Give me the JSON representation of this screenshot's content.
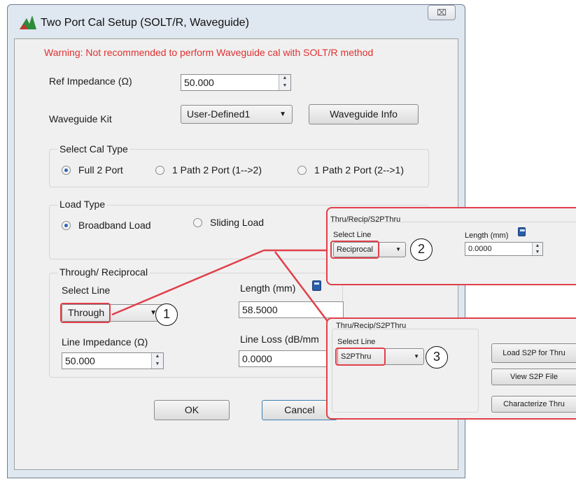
{
  "window": {
    "title": "Two Port Cal Setup (SOLT/R, Waveguide)",
    "close_glyph": "⌧"
  },
  "warning": "Warning:  Not recommended to perform Waveguide cal with SOLT/R method",
  "ref_impedance": {
    "label": "Ref Impedance (Ω)",
    "value": "50.000"
  },
  "waveguide_kit": {
    "label": "Waveguide  Kit",
    "selected": "User-Defined1",
    "info_button": "Waveguide Info"
  },
  "cal_type": {
    "legend": "Select Cal Type",
    "options": [
      "Full 2 Port",
      "1 Path 2 Port (1-->2)",
      "1 Path 2 Port (2-->1)"
    ],
    "selected_index": 0
  },
  "load_type": {
    "legend": "Load Type",
    "options": [
      "Broadband Load",
      "Sliding Load"
    ],
    "selected_index": 0
  },
  "through": {
    "legend": "Through/ Reciprocal",
    "select_line_label": "Select Line",
    "select_line_value": "Through",
    "length_label": "Length (mm)",
    "length_value": "58.5000",
    "line_impedance_label": "Line Impedance (Ω)",
    "line_impedance_value": "50.000",
    "line_loss_label": "Line Loss (dB/mm",
    "line_loss_value": "0.0000"
  },
  "buttons": {
    "ok": "OK",
    "cancel": "Cancel"
  },
  "callout2": {
    "title": "Thru/Recip/S2PThru",
    "select_line_label": "Select Line",
    "select_line_value": "Reciprocal",
    "length_label": "Length (mm)",
    "length_value": "0.0000"
  },
  "callout3": {
    "title": "Thru/Recip/S2PThru",
    "select_line_label": "Select Line",
    "select_line_value": "S2PThru",
    "load_button": "Load S2P for Thru",
    "view_button": "View S2P File",
    "characterize_button": "Characterize Thru"
  },
  "markers": [
    "1",
    "2",
    "3"
  ],
  "colors": {
    "accent_red": "#e0404a",
    "warning_red": "#e03030",
    "radio_selected": "#2f66b3"
  },
  "icons": {
    "app": "app-logo-icon",
    "calculator": "calculator-icon",
    "dropdown": "dropdown-arrow-icon"
  }
}
